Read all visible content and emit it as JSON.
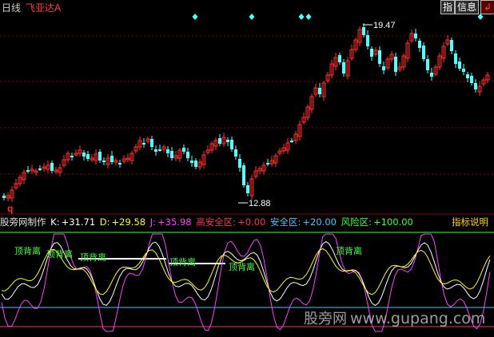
{
  "toolbar": {
    "period_label": "日线",
    "stock_name": "飞亚达A",
    "zhi_label": "指",
    "info_label": "信息",
    "restore_icon": "restore-window-icon"
  },
  "price_chart": {
    "high_label": "19.47",
    "low_label": "12.88",
    "marker_label": "q",
    "colors": {
      "up": "#ff3030",
      "down": "#54ffff",
      "grid": "#8b0000",
      "diamond": "#54ffff"
    }
  },
  "indicator": {
    "title": "股旁网制作",
    "k_label": "K:",
    "k_value": "+31.71",
    "d_label": "D:",
    "d_value": "+29.58",
    "j_label": "J:",
    "j_value": "+35.98",
    "high_safe_label": "高安全区:",
    "high_safe_value": "+0.00",
    "safe_label": "安全区:",
    "safe_value": "+20.00",
    "risk_label": "风险区:",
    "risk_value": "+100.00",
    "explain_label": "指标说明",
    "divergence_label": "顶背离",
    "colors": {
      "k": "#ffffff",
      "d": "#ffff00",
      "j": "#ff40ff",
      "safe": "#40c8ff",
      "risk": "#40ff40",
      "highsafe": "#ff3060"
    }
  },
  "watermark": {
    "cn": "股旁网",
    "url": "www.gupang.com"
  }
}
